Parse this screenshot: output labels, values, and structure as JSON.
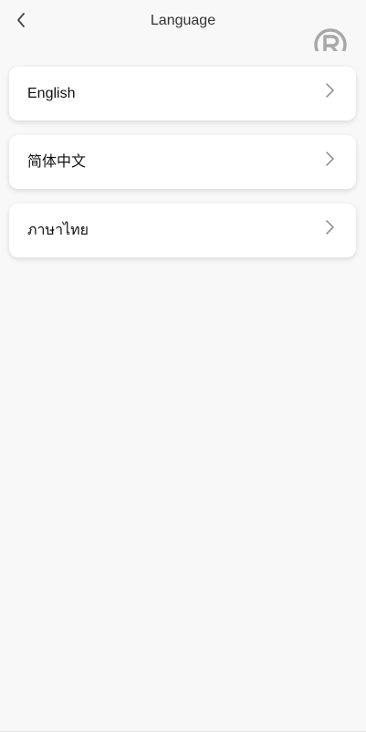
{
  "header": {
    "title": "Language",
    "back_icon": "chevron-left-icon",
    "logo_icon": "registered-trademark-logo"
  },
  "languages": [
    {
      "label": "English",
      "icon": "chevron-right-icon"
    },
    {
      "label": "简体中文",
      "icon": "chevron-right-icon"
    },
    {
      "label": "ภาษาไทย",
      "icon": "chevron-right-icon"
    }
  ],
  "colors": {
    "background": "#f8f8f8",
    "card": "#ffffff",
    "text": "#111111",
    "icon": "#888888",
    "logo": "#a8a8a8"
  }
}
